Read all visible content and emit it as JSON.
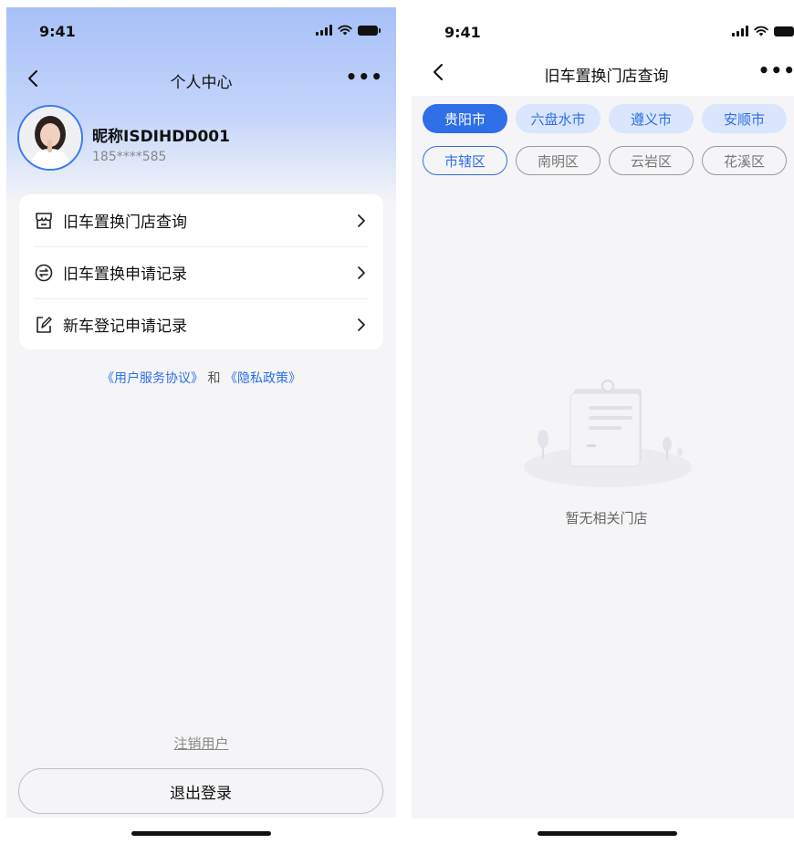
{
  "left_screen": {
    "status_time": "9:41",
    "title": "个人中心",
    "more_label": "•••",
    "profile": {
      "nickname": "昵称ISDIHDD001",
      "phone": "185****585"
    },
    "menu": [
      {
        "label": "旧车置换门店查询",
        "icon": "store-icon"
      },
      {
        "label": "旧车置换申请记录",
        "icon": "exchange-icon"
      },
      {
        "label": "新车登记申请记录",
        "icon": "edit-icon"
      }
    ],
    "agreement": {
      "user_agreement": "《用户服务协议》",
      "connector": "和",
      "privacy_policy": "《隐私政策》"
    },
    "cancel_user": "注销用户",
    "logout": "退出登录"
  },
  "right_screen": {
    "status_time": "9:41",
    "title": "旧车置换门店查询",
    "more_label": "•••",
    "cities": [
      {
        "label": "贵阳市",
        "selected": true
      },
      {
        "label": "六盘水市",
        "selected": false
      },
      {
        "label": "遵义市",
        "selected": false
      },
      {
        "label": "安顺市",
        "selected": false
      }
    ],
    "districts": [
      {
        "label": "市辖区",
        "selected": true
      },
      {
        "label": "南明区",
        "selected": false
      },
      {
        "label": "云岩区",
        "selected": false
      },
      {
        "label": "花溪区",
        "selected": false
      }
    ],
    "empty_text": "暂无相关门店"
  },
  "colors": {
    "accent": "#2f6fe8",
    "chip_bg": "#d9e6fd",
    "page_bg": "#f5f5f7"
  }
}
